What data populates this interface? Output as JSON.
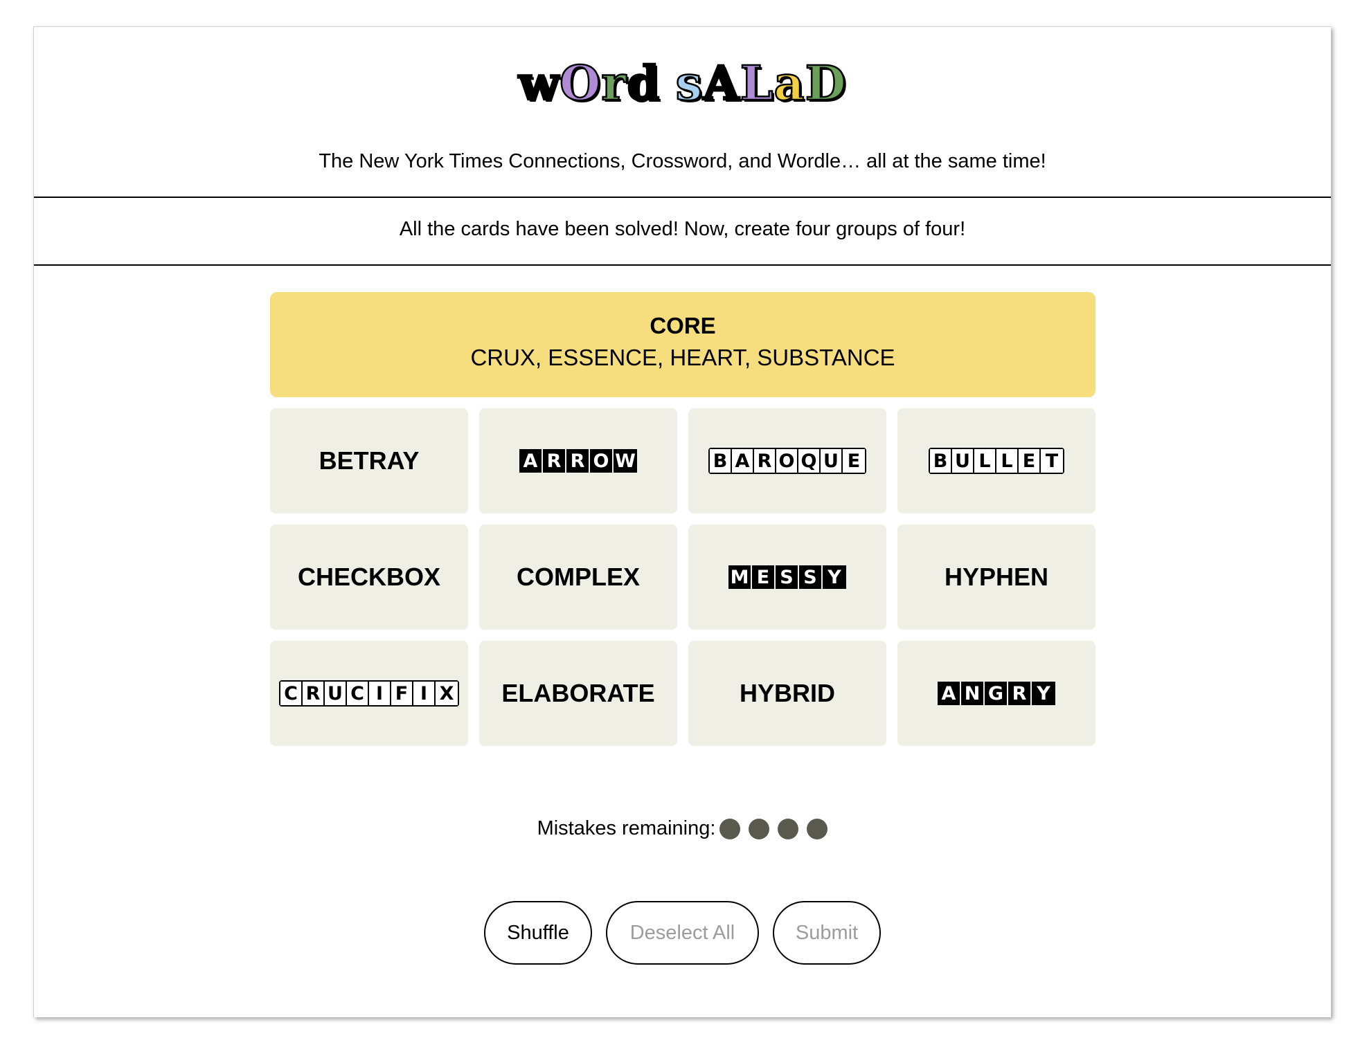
{
  "logo": {
    "letters": [
      {
        "char": "w",
        "color": "#000000"
      },
      {
        "char": "O",
        "color": "#b18ad6"
      },
      {
        "char": "r",
        "color": "#6aa05a"
      },
      {
        "char": "d",
        "color": "#000000"
      },
      {
        "char": "s",
        "color": "#a7cff0"
      },
      {
        "char": "A",
        "color": "#000000"
      },
      {
        "char": "L",
        "color": "#b18ad6"
      },
      {
        "char": "a",
        "color": "#f3cf45"
      },
      {
        "char": "D",
        "color": "#6aa05a"
      }
    ]
  },
  "header": {
    "subtitle": "The New York Times Connections, Crossword, and Wordle… all at the same time!"
  },
  "notice": "All the cards have been solved! Now, create four groups of four!",
  "solved_group": {
    "category": "CORE",
    "words": "CRUX, ESSENCE, HEART, SUBSTANCE",
    "color": "#f6de7f"
  },
  "cards": [
    {
      "word": "BETRAY",
      "style": "plain"
    },
    {
      "word": "ARROW",
      "style": "filled"
    },
    {
      "word": "BAROQUE",
      "style": "outline"
    },
    {
      "word": "BULLET",
      "style": "outline"
    },
    {
      "word": "CHECKBOX",
      "style": "plain"
    },
    {
      "word": "COMPLEX",
      "style": "plain"
    },
    {
      "word": "MESSY",
      "style": "filled"
    },
    {
      "word": "HYPHEN",
      "style": "plain"
    },
    {
      "word": "CRUCIFIX",
      "style": "outline"
    },
    {
      "word": "ELABORATE",
      "style": "plain"
    },
    {
      "word": "HYBRID",
      "style": "plain"
    },
    {
      "word": "ANGRY",
      "style": "filled"
    }
  ],
  "mistakes": {
    "label": "Mistakes remaining:",
    "remaining": 4,
    "dot_color": "#5a594e"
  },
  "buttons": {
    "shuffle": "Shuffle",
    "deselect_all": "Deselect All",
    "submit": "Submit"
  }
}
